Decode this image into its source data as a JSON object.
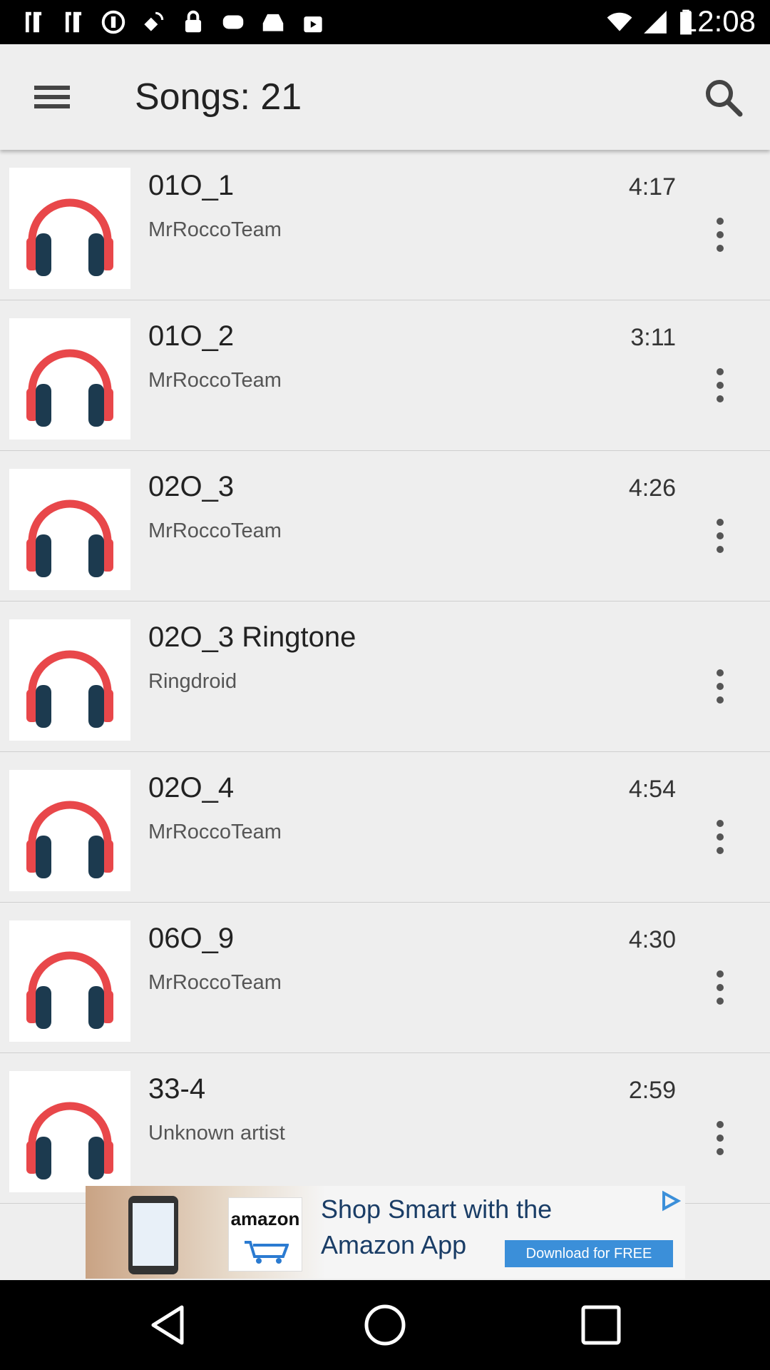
{
  "status_bar": {
    "time": "12:08",
    "icons": [
      "wifi-icon",
      "cellular-icon",
      "battery-icon"
    ]
  },
  "app_bar": {
    "title": "Songs: 21",
    "menu_icon": "hamburger-menu-icon",
    "search_icon": "search-icon"
  },
  "songs": [
    {
      "title": "01O_1",
      "artist": "MrRoccoTeam",
      "duration": "4:17"
    },
    {
      "title": "01O_2",
      "artist": "MrRoccoTeam",
      "duration": "3:11"
    },
    {
      "title": "02O_3",
      "artist": "MrRoccoTeam",
      "duration": "4:26"
    },
    {
      "title": "02O_3 Ringtone",
      "artist": "Ringdroid",
      "duration": ""
    },
    {
      "title": "02O_4",
      "artist": "MrRoccoTeam",
      "duration": "4:54"
    },
    {
      "title": "06O_9",
      "artist": "MrRoccoTeam",
      "duration": "4:30"
    },
    {
      "title": "33-4",
      "artist": "Unknown artist",
      "duration": "2:59"
    }
  ],
  "ad": {
    "logo_text": "amazon",
    "line1": "Shop Smart with the",
    "line2": "Amazon App",
    "cta": "Download for FREE"
  },
  "colors": {
    "headphone_red": "#e8474a",
    "headphone_dark": "#1c3a4f",
    "background": "#eeeeee"
  }
}
